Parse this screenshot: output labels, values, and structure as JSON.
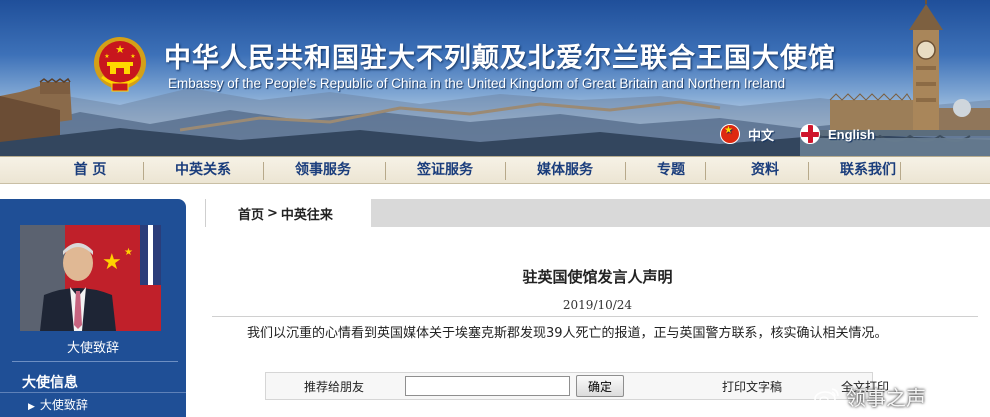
{
  "header": {
    "title_cn": "中华人民共和国驻大不列颠及北爱尔兰联合王国大使馆",
    "title_en": "Embassy of the People's Republic of China in the United Kingdom of Great Britain and Northern Ireland",
    "lang_cn": "中文",
    "lang_en": "English"
  },
  "nav": {
    "items": [
      "首 页",
      "中英关系",
      "领事服务",
      "签证服务",
      "媒体服务",
      "专题",
      "资料",
      "联系我们"
    ]
  },
  "sidebar": {
    "ambassador_caption": "大使致辞",
    "section_heading": "大使信息",
    "items": [
      "大使致辞"
    ]
  },
  "breadcrumb": {
    "home": "首页",
    "separator": ">",
    "current": "中英往来"
  },
  "article": {
    "title": "驻英国使馆发言人声明",
    "date": "2019/10/24",
    "body": "我们以沉重的心情看到英国媒体关于埃塞克斯郡发现39人死亡的报道，正与英国警方联系，核实确认相关情况。"
  },
  "tools": {
    "recommend_label": "推荐给朋友",
    "recommend_value": "",
    "ok_button": "确定",
    "print_label": "打印文字稿",
    "fulltext_label": "全文打印"
  },
  "watermark": {
    "text": "领事之声"
  },
  "colors": {
    "nav_text": "#1a3d7c",
    "sidebar_bg": "#1f4f96",
    "banner_top": "#1f4f9a"
  },
  "icons": [
    "national-emblem-icon",
    "china-flag-icon",
    "uk-flag-icon",
    "arrow-right-icon",
    "weibo-logo-icon"
  ]
}
